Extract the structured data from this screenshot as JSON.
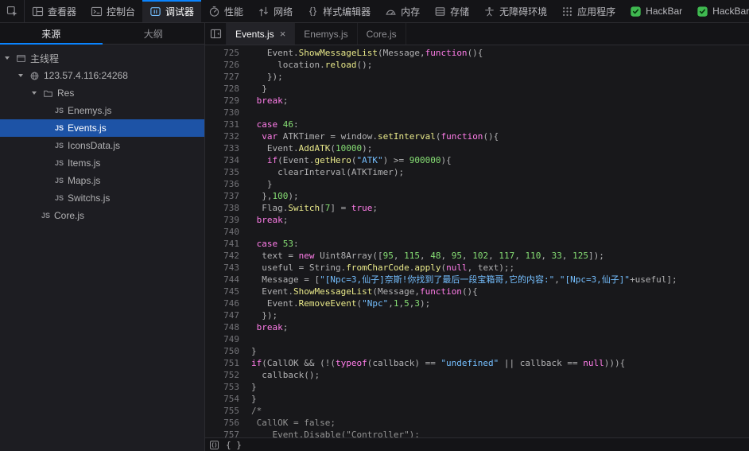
{
  "colors": {
    "accent": "#0a84ff",
    "selection": "#1d53a6",
    "hackbar_green": "#3fb950",
    "syntax_keyword": "#ff7de9",
    "syntax_number": "#86de74",
    "syntax_string": "#75bfff",
    "syntax_property": "#e9e98a",
    "syntax_comment": "#939393",
    "syntax_plain": "#b1b1b3"
  },
  "toolbar": {
    "tabs": [
      {
        "label": "查看器",
        "icon": "inspector"
      },
      {
        "label": "控制台",
        "icon": "console"
      },
      {
        "label": "调试器",
        "icon": "debugger",
        "active": true
      },
      {
        "label": "性能",
        "icon": "performance"
      },
      {
        "label": "网络",
        "icon": "network"
      },
      {
        "label": "样式编辑器",
        "icon": "style-editor"
      },
      {
        "label": "内存",
        "icon": "memory"
      },
      {
        "label": "存储",
        "icon": "storage"
      },
      {
        "label": "无障碍环境",
        "icon": "accessibility"
      },
      {
        "label": "应用程序",
        "icon": "application"
      },
      {
        "label": "HackBar",
        "icon": "hackbar"
      },
      {
        "label": "HackBar",
        "icon": "hackbar"
      }
    ]
  },
  "sidebar": {
    "tabs": [
      {
        "label": "来源",
        "key": "sources",
        "active": true
      },
      {
        "label": "大纲",
        "key": "outline"
      }
    ],
    "tree": [
      {
        "label": "主线程",
        "key": "main-thread",
        "type": "thread",
        "depth": 0,
        "expanded": true
      },
      {
        "label": "123.57.4.116:24268",
        "key": "host-123-57-4-116",
        "type": "host",
        "depth": 1,
        "expanded": true
      },
      {
        "label": "Res",
        "key": "res-folder",
        "type": "folder",
        "depth": 2,
        "expanded": true
      },
      {
        "label": "Enemys.js",
        "key": "enemys-js",
        "type": "js",
        "depth": 3
      },
      {
        "label": "Events.js",
        "key": "events-js",
        "type": "js",
        "depth": 3,
        "selected": true
      },
      {
        "label": "IconsData.js",
        "key": "iconsdata-js",
        "type": "js",
        "depth": 3
      },
      {
        "label": "Items.js",
        "key": "items-js",
        "type": "js",
        "depth": 3
      },
      {
        "label": "Maps.js",
        "key": "maps-js",
        "type": "js",
        "depth": 3
      },
      {
        "label": "Switchs.js",
        "key": "switchs-js",
        "type": "js",
        "depth": 3
      },
      {
        "label": "Core.js",
        "key": "core-js",
        "type": "js",
        "depth": 2
      }
    ]
  },
  "editor": {
    "tabs": [
      {
        "label": "Events.js",
        "key": "events-js",
        "active": true,
        "closable": true
      },
      {
        "label": "Enemys.js",
        "key": "enemys-js"
      },
      {
        "label": "Core.js",
        "key": "core-js"
      }
    ],
    "lines": [
      {
        "n": 725,
        "indent": 3,
        "toks": [
          [
            "t",
            "Event."
          ],
          [
            "p",
            "ShowMessageList"
          ],
          [
            "t",
            "(Message,"
          ],
          [
            "k",
            "function"
          ],
          [
            "t",
            "(){"
          ]
        ]
      },
      {
        "n": 726,
        "indent": 5,
        "toks": [
          [
            "t",
            "location."
          ],
          [
            "p",
            "reload"
          ],
          [
            "t",
            "();"
          ]
        ]
      },
      {
        "n": 727,
        "indent": 3,
        "toks": [
          [
            "t",
            "});"
          ]
        ]
      },
      {
        "n": 728,
        "indent": 2,
        "toks": [
          [
            "t",
            "}"
          ]
        ]
      },
      {
        "n": 729,
        "indent": 1,
        "toks": [
          [
            "k",
            "break"
          ],
          [
            "t",
            ";"
          ]
        ]
      },
      {
        "n": 730,
        "indent": 0,
        "toks": []
      },
      {
        "n": 731,
        "indent": 1,
        "toks": [
          [
            "k",
            "case"
          ],
          [
            "t",
            " "
          ],
          [
            "n",
            "46"
          ],
          [
            "t",
            ":"
          ]
        ]
      },
      {
        "n": 732,
        "indent": 2,
        "toks": [
          [
            "k",
            "var"
          ],
          [
            "t",
            " ATKTimer = window."
          ],
          [
            "p",
            "setInterval"
          ],
          [
            "t",
            "("
          ],
          [
            "k",
            "function"
          ],
          [
            "t",
            "(){"
          ]
        ]
      },
      {
        "n": 733,
        "indent": 3,
        "toks": [
          [
            "t",
            "Event."
          ],
          [
            "p",
            "AddATK"
          ],
          [
            "t",
            "("
          ],
          [
            "n",
            "10000"
          ],
          [
            "t",
            ");"
          ]
        ]
      },
      {
        "n": 734,
        "indent": 3,
        "toks": [
          [
            "k",
            "if"
          ],
          [
            "t",
            "(Event."
          ],
          [
            "p",
            "getHero"
          ],
          [
            "t",
            "("
          ],
          [
            "s",
            "\"ATK\""
          ],
          [
            "t",
            ") >= "
          ],
          [
            "n",
            "900000"
          ],
          [
            "t",
            "){"
          ]
        ]
      },
      {
        "n": 735,
        "indent": 5,
        "toks": [
          [
            "t",
            "clearInterval(ATKTimer);"
          ]
        ]
      },
      {
        "n": 736,
        "indent": 3,
        "toks": [
          [
            "t",
            "}"
          ]
        ]
      },
      {
        "n": 737,
        "indent": 2,
        "toks": [
          [
            "t",
            "},"
          ],
          [
            "n",
            "100"
          ],
          [
            "t",
            ");"
          ]
        ]
      },
      {
        "n": 738,
        "indent": 2,
        "toks": [
          [
            "t",
            "Flag."
          ],
          [
            "p",
            "Switch"
          ],
          [
            "t",
            "["
          ],
          [
            "n",
            "7"
          ],
          [
            "t",
            "] = "
          ],
          [
            "k",
            "true"
          ],
          [
            "t",
            ";"
          ]
        ]
      },
      {
        "n": 739,
        "indent": 1,
        "toks": [
          [
            "k",
            "break"
          ],
          [
            "t",
            ";"
          ]
        ]
      },
      {
        "n": 740,
        "indent": 0,
        "toks": []
      },
      {
        "n": 741,
        "indent": 1,
        "toks": [
          [
            "k",
            "case"
          ],
          [
            "t",
            " "
          ],
          [
            "n",
            "53"
          ],
          [
            "t",
            ":"
          ]
        ]
      },
      {
        "n": 742,
        "indent": 2,
        "toks": [
          [
            "t",
            "text = "
          ],
          [
            "k",
            "new"
          ],
          [
            "t",
            " Uint8Array(["
          ],
          [
            "n",
            "95"
          ],
          [
            "t",
            ", "
          ],
          [
            "n",
            "115"
          ],
          [
            "t",
            ", "
          ],
          [
            "n",
            "48"
          ],
          [
            "t",
            ", "
          ],
          [
            "n",
            "95"
          ],
          [
            "t",
            ", "
          ],
          [
            "n",
            "102"
          ],
          [
            "t",
            ", "
          ],
          [
            "n",
            "117"
          ],
          [
            "t",
            ", "
          ],
          [
            "n",
            "110"
          ],
          [
            "t",
            ", "
          ],
          [
            "n",
            "33"
          ],
          [
            "t",
            ", "
          ],
          [
            "n",
            "125"
          ],
          [
            "t",
            "]);"
          ]
        ]
      },
      {
        "n": 743,
        "indent": 2,
        "toks": [
          [
            "t",
            "useful = String."
          ],
          [
            "p",
            "fromCharCode"
          ],
          [
            "t",
            "."
          ],
          [
            "p",
            "apply"
          ],
          [
            "t",
            "("
          ],
          [
            "k",
            "null"
          ],
          [
            "t",
            ", text);;"
          ]
        ]
      },
      {
        "n": 744,
        "indent": 2,
        "toks": [
          [
            "t",
            "Message = ["
          ],
          [
            "s",
            "\"[Npc=3,仙子]奈斯!你找到了最后一段宝箱哥,它的内容:\""
          ],
          [
            "t",
            ","
          ],
          [
            "s",
            "\"[Npc=3,仙子]\""
          ],
          [
            "t",
            "+useful];"
          ]
        ]
      },
      {
        "n": 745,
        "indent": 2,
        "toks": [
          [
            "t",
            "Event."
          ],
          [
            "p",
            "ShowMessageList"
          ],
          [
            "t",
            "(Message,"
          ],
          [
            "k",
            "function"
          ],
          [
            "t",
            "(){"
          ]
        ]
      },
      {
        "n": 746,
        "indent": 3,
        "toks": [
          [
            "t",
            "Event."
          ],
          [
            "p",
            "RemoveEvent"
          ],
          [
            "t",
            "("
          ],
          [
            "s",
            "\"Npc\""
          ],
          [
            "t",
            ","
          ],
          [
            "n",
            "1"
          ],
          [
            "t",
            ","
          ],
          [
            "n",
            "5"
          ],
          [
            "t",
            ","
          ],
          [
            "n",
            "3"
          ],
          [
            "t",
            ");"
          ]
        ]
      },
      {
        "n": 747,
        "indent": 2,
        "toks": [
          [
            "t",
            "});"
          ]
        ]
      },
      {
        "n": 748,
        "indent": 1,
        "toks": [
          [
            "k",
            "break"
          ],
          [
            "t",
            ";"
          ]
        ]
      },
      {
        "n": 749,
        "indent": 0,
        "toks": []
      },
      {
        "n": 750,
        "indent": 0,
        "toks": [
          [
            "t",
            "}"
          ]
        ]
      },
      {
        "n": 751,
        "indent": 0,
        "toks": [
          [
            "k",
            "if"
          ],
          [
            "t",
            "(CallOK && (!("
          ],
          [
            "k",
            "typeof"
          ],
          [
            "t",
            "(callback) == "
          ],
          [
            "s",
            "\"undefined\""
          ],
          [
            "t",
            " || callback == "
          ],
          [
            "k",
            "null"
          ],
          [
            "t",
            "))){"
          ]
        ]
      },
      {
        "n": 752,
        "indent": 2,
        "toks": [
          [
            "t",
            "callback();"
          ]
        ]
      },
      {
        "n": 753,
        "indent": 0,
        "toks": [
          [
            "t",
            "}"
          ]
        ]
      },
      {
        "n": 754,
        "indent": 0,
        "toks": [
          [
            "t",
            "}"
          ]
        ]
      },
      {
        "n": 755,
        "indent": 0,
        "toks": [
          [
            "c",
            "/*"
          ]
        ]
      },
      {
        "n": 756,
        "indent": 1,
        "toks": [
          [
            "c",
            "CallOK = false;"
          ]
        ]
      },
      {
        "n": 757,
        "indent": 4,
        "toks": [
          [
            "c",
            "Event.Disable(\"Controller\");"
          ]
        ]
      }
    ]
  },
  "footer": {
    "braces_label": "{ }"
  }
}
